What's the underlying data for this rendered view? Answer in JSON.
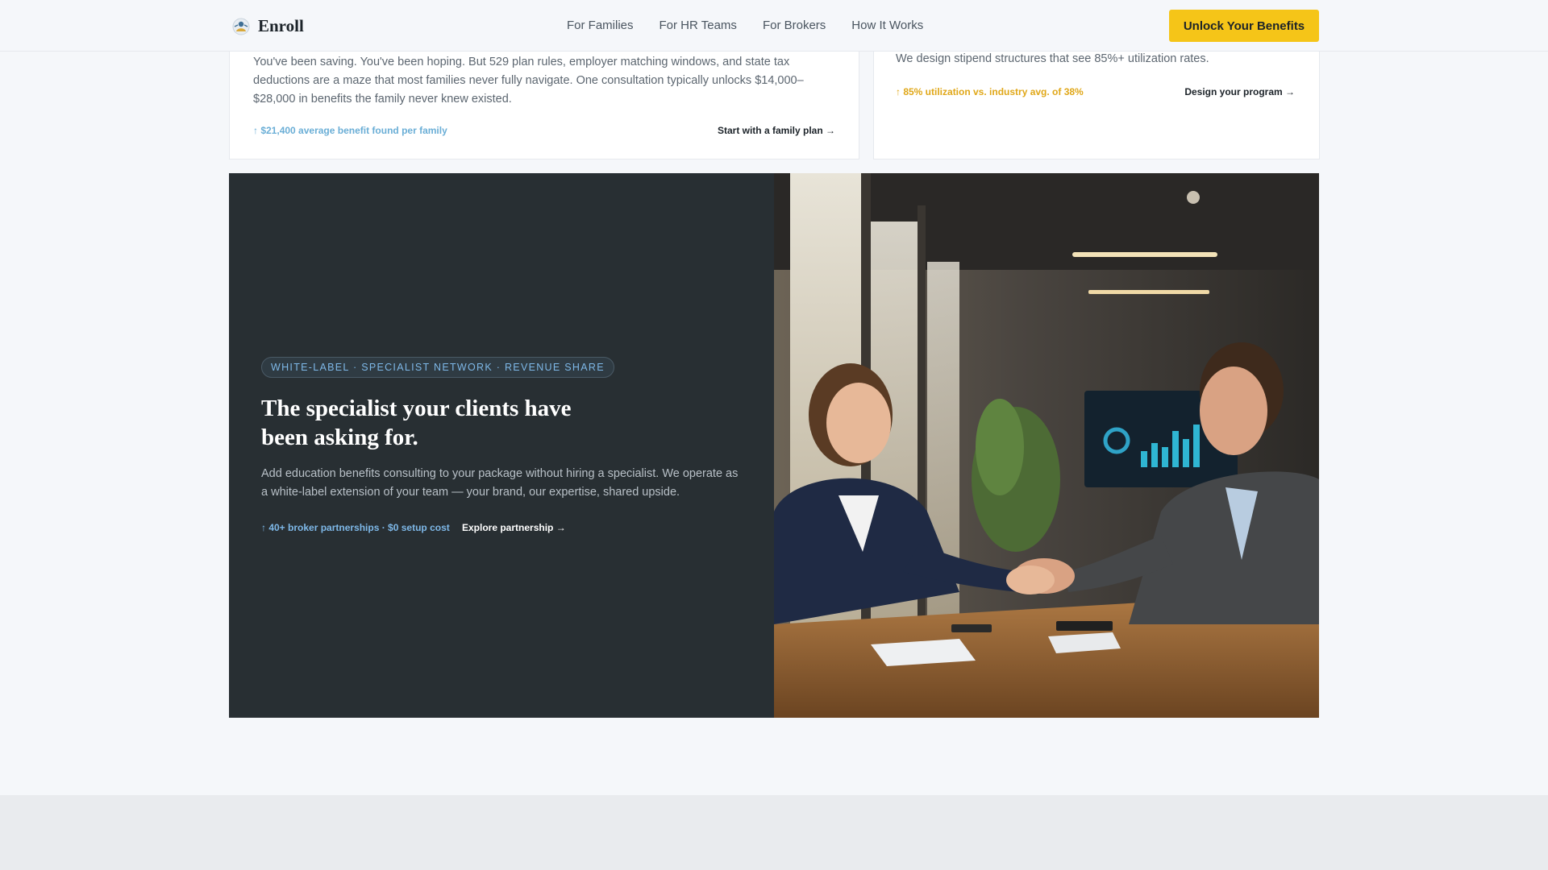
{
  "header": {
    "brand": "Enroll",
    "nav": [
      "For Families",
      "For HR Teams",
      "For Brokers",
      "How It Works"
    ],
    "cta": "Unlock Your Benefits"
  },
  "families_card": {
    "body": "You've been saving. You've been hoping. But 529 plan rules, employer matching windows, and state tax deductions are a maze that most families never fully navigate. One consultation typically unlocks $14,000–$28,000 in benefits the family never knew existed.",
    "stat": "↑ $21,400 average benefit found per family",
    "link": "Start with a family plan →"
  },
  "hr_card": {
    "body": "We design stipend structures that see 85%+ utilization rates.",
    "stat": "↑ 85% utilization vs. industry avg. of 38%",
    "link": "Design your program →"
  },
  "broker_feature": {
    "pill": "WHITE-LABEL · SPECIALIST NETWORK · REVENUE SHARE",
    "title": "The specialist your clients have been asking for.",
    "body": "Add education benefits consulting to your package without hiring a specialist. We operate as a white-label extension of your team — your brand, our expertise, shared upside.",
    "stat": "↑ 40+ broker partnerships · $0 setup cost",
    "link": "Explore partnership →"
  },
  "colors": {
    "accent_yellow": "#f5c518",
    "dark_panel": "#282f33",
    "stat_blue": "#7eb8e8",
    "stat_gold": "#e0a718"
  }
}
